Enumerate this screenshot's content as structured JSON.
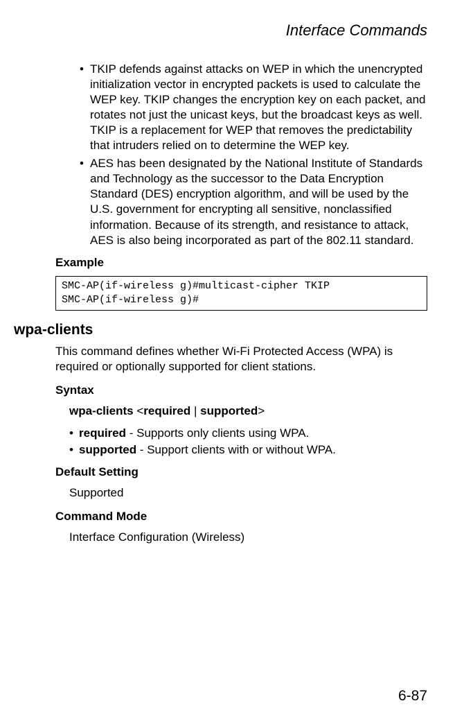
{
  "header": {
    "title": "Interface Commands"
  },
  "bullets": {
    "b1": "TKIP defends against attacks on WEP in which the unencrypted initialization vector in encrypted packets is used to calculate the WEP key. TKIP changes the encryption key on each packet, and rotates not just the unicast keys, but the broadcast keys as well. TKIP is a replacement for WEP that removes the predictability that intruders relied on to determine the WEP key.",
    "b2": "AES has been designated by the National Institute of Standards and Technology as the successor to the Data Encryption Standard (DES) encryption algorithm, and will be used by the U.S. government for encrypting all sensitive, nonclassified information. Because of its strength, and resistance to attack, AES is also being incorporated as part of the 802.11 standard."
  },
  "labels": {
    "example": "Example",
    "syntax": "Syntax",
    "default_setting": "Default Setting",
    "command_mode": "Command Mode"
  },
  "code": {
    "line1": "SMC-AP(if-wireless g)#multicast-cipher TKIP",
    "line2": "SMC-AP(if-wireless g)#"
  },
  "command": {
    "title": "wpa-clients",
    "description": "This command defines whether Wi-Fi Protected Access (WPA) is required or optionally supported for client stations.",
    "syntax_cmd": "wpa-clients",
    "syntax_lt": " <",
    "syntax_opt1": "required",
    "syntax_pipe": " | ",
    "syntax_opt2": "supported",
    "syntax_gt": ">",
    "opt_required_label": "required",
    "opt_required_desc": " - Supports only clients using WPA.",
    "opt_supported_label": "supported",
    "opt_supported_desc": " - Support clients with or without WPA.",
    "default_value": "Supported",
    "command_mode_value": "Interface Configuration (Wireless)"
  },
  "page_number": "6-87"
}
